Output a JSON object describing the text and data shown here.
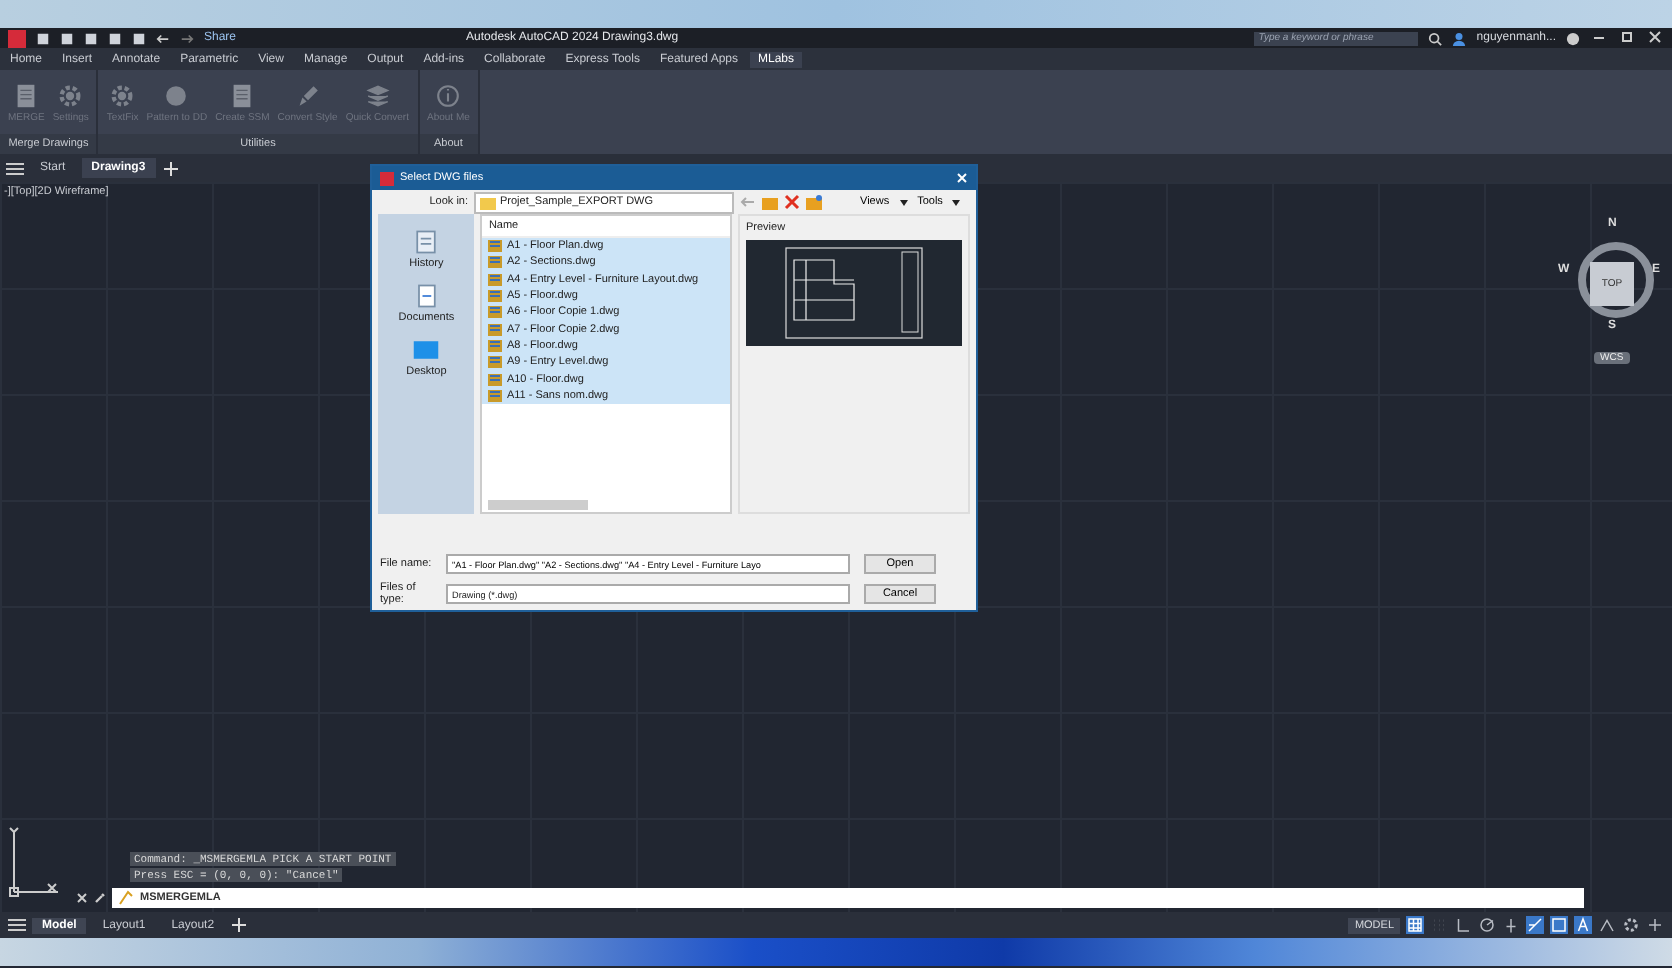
{
  "title_bar": {
    "share": "Share",
    "title": "Autodesk AutoCAD 2024   Drawing3.dwg",
    "search_placeholder": "Type a keyword or phrase",
    "user": "nguyenmanh..."
  },
  "ribbon_tabs": [
    {
      "label": "Home",
      "selected": false
    },
    {
      "label": "Insert",
      "selected": false
    },
    {
      "label": "Annotate",
      "selected": false
    },
    {
      "label": "Parametric",
      "selected": false
    },
    {
      "label": "View",
      "selected": false
    },
    {
      "label": "Manage",
      "selected": false
    },
    {
      "label": "Output",
      "selected": false
    },
    {
      "label": "Add-ins",
      "selected": false
    },
    {
      "label": "Collaborate",
      "selected": false
    },
    {
      "label": "Express Tools",
      "selected": false
    },
    {
      "label": "Featured Apps",
      "selected": false
    },
    {
      "label": "MLabs",
      "selected": true
    }
  ],
  "ribbon_panels": [
    {
      "title": "Merge Drawings",
      "buttons": [
        {
          "kind": "doc",
          "label": "MERGE"
        },
        {
          "kind": "gear",
          "label": "Settings"
        }
      ]
    },
    {
      "title": "Utilities",
      "buttons": [
        {
          "kind": "gear",
          "label": "TextFix"
        },
        {
          "kind": "ball",
          "label": "Pattern to DD"
        },
        {
          "kind": "doc",
          "label": "Create SSM"
        },
        {
          "kind": "brush",
          "label": "Convert Style"
        },
        {
          "kind": "stack",
          "label": "Quick Convert"
        }
      ]
    },
    {
      "title": "About",
      "buttons": [
        {
          "kind": "info",
          "label": "About Me"
        }
      ]
    }
  ],
  "file_tabs": [
    {
      "label": "Start",
      "selected": false
    },
    {
      "label": "Drawing3",
      "selected": true
    }
  ],
  "viewport_label": "-][Top][2D Wireframe]",
  "viewcube": {
    "top": "TOP",
    "north": "N",
    "south": "S",
    "east": "E",
    "west": "W",
    "wcs": "WCS"
  },
  "dialog": {
    "title": "Select DWG files",
    "look_in_label": "Look in:",
    "look_in": "Projet_Sample_EXPORT DWG",
    "views": "Views",
    "tools": "Tools",
    "places": [
      {
        "kind": "history",
        "label": "History"
      },
      {
        "kind": "documents",
        "label": "Documents"
      },
      {
        "kind": "desktop",
        "label": "Desktop"
      }
    ],
    "column": "Name",
    "preview_label": "Preview",
    "files": [
      {
        "name": "A1 - Floor Plan.dwg",
        "selected": true
      },
      {
        "name": "A2 - Sections.dwg",
        "selected": true
      },
      {
        "name": "A4 - Entry Level - Furniture Layout.dwg",
        "selected": true
      },
      {
        "name": "A5 - Floor.dwg",
        "selected": true
      },
      {
        "name": "A6 - Floor Copie 1.dwg",
        "selected": true
      },
      {
        "name": "A7 - Floor Copie 2.dwg",
        "selected": true
      },
      {
        "name": "A8 - Floor.dwg",
        "selected": true
      },
      {
        "name": "A9 - Entry Level.dwg",
        "selected": true
      },
      {
        "name": "A10 - Floor.dwg",
        "selected": true
      },
      {
        "name": "A11 - Sans nom.dwg",
        "selected": true
      }
    ],
    "file_name_label": "File name:",
    "file_name": "\"A1 - Floor Plan.dwg\" \"A2 - Sections.dwg\" \"A4 - Entry Level - Furniture Layo",
    "files_of_type_label": "Files of type:",
    "files_of_type": "Drawing (*.dwg)",
    "open": "Open",
    "cancel": "Cancel"
  },
  "command_history": [
    "Command: _MSMERGEMLA PICK A START POINT",
    "Press ESC = (0, 0, 0): \"Cancel\""
  ],
  "command_input": "MSMERGEMLA",
  "layout_tabs": [
    {
      "label": "Model",
      "selected": true
    },
    {
      "label": "Layout1",
      "selected": false
    },
    {
      "label": "Layout2",
      "selected": false
    }
  ],
  "status_bar": {
    "model": "MODEL",
    "toggles": [
      {
        "kind": "grid",
        "on": true
      },
      {
        "kind": "snap",
        "on": false
      },
      {
        "kind": "ortho",
        "on": false
      },
      {
        "kind": "polar",
        "on": false
      },
      {
        "kind": "iso",
        "on": false
      },
      {
        "kind": "track",
        "on": true
      },
      {
        "kind": "osnap",
        "on": true
      },
      {
        "kind": "annot",
        "on": true
      },
      {
        "kind": "scale",
        "on": false
      },
      {
        "kind": "gear",
        "on": false
      },
      {
        "kind": "plus",
        "on": false
      }
    ]
  }
}
